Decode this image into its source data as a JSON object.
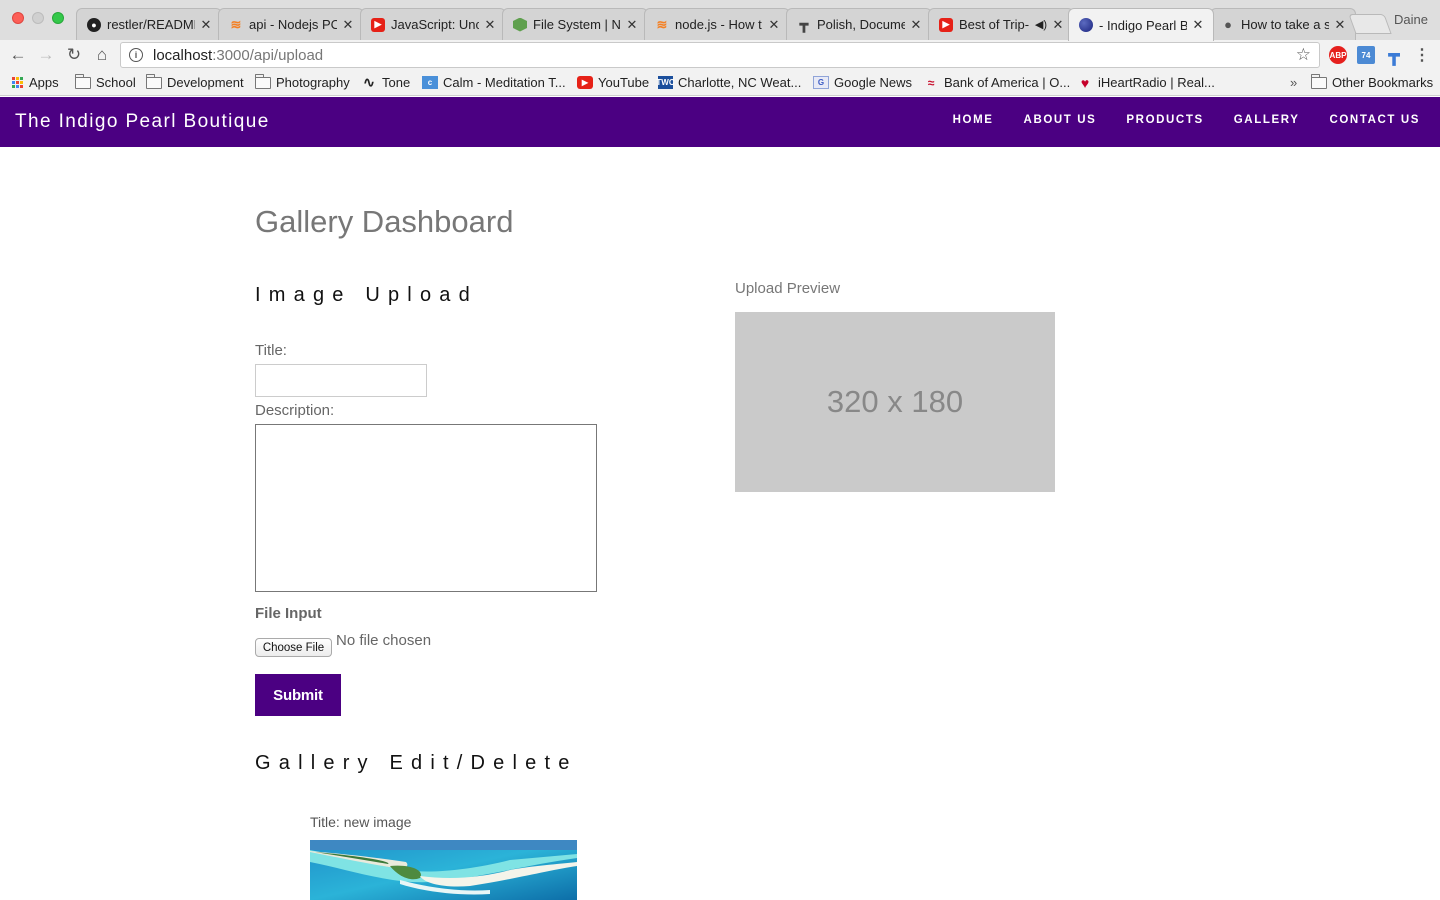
{
  "browser": {
    "tabs": [
      {
        "title": "restler/README",
        "icon": "github-icon",
        "color": "#222222",
        "active": false
      },
      {
        "title": "api - Nodejs PC",
        "icon": "stackoverflow-icon",
        "color": "#f48024",
        "active": false
      },
      {
        "title": "JavaScript: Unc",
        "icon": "youtube-icon",
        "color": "#e62117",
        "active": false
      },
      {
        "title": "File System | N",
        "icon": "nodejs-icon",
        "color": "#5fa04e",
        "active": false
      },
      {
        "title": "node.js - How t",
        "icon": "stackoverflow-icon",
        "color": "#f48024",
        "active": false
      },
      {
        "title": "Polish, Docume",
        "icon": "typewriter-icon",
        "color": "#444444",
        "active": false
      },
      {
        "title": "Best of Trip-",
        "icon": "youtube-icon",
        "color": "#e62117",
        "active": false
      },
      {
        "title": "- Indigo Pearl B",
        "icon": "globe-icon",
        "color": "#1a237e",
        "active": true
      },
      {
        "title": "How to take a s",
        "icon": "apple-icon",
        "color": "#555555",
        "active": false
      }
    ],
    "profile_name": "Daine",
    "url_host": "localhost",
    "url_path": ":3000/api/upload",
    "extensions": {
      "abp": "ABP",
      "cal": "74"
    },
    "bookmarks": [
      {
        "label": "Apps",
        "icon": "apps-grid-icon"
      },
      {
        "label": "School",
        "icon": "folder-icon"
      },
      {
        "label": "Development",
        "icon": "folder-icon"
      },
      {
        "label": "Photography",
        "icon": "folder-icon"
      },
      {
        "label": "Tone",
        "icon": "tone-wave-icon"
      },
      {
        "label": "Calm - Meditation T...",
        "icon": "calm-icon"
      },
      {
        "label": "YouTube",
        "icon": "youtube-icon"
      },
      {
        "label": "Charlotte, NC Weat...",
        "icon": "weather-channel-icon"
      },
      {
        "label": "Google News",
        "icon": "google-news-icon"
      },
      {
        "label": "Bank of America | O...",
        "icon": "bank-of-america-icon"
      },
      {
        "label": "iHeartRadio | Real...",
        "icon": "iheartradio-icon"
      }
    ],
    "bookmarks_overflow": "»",
    "other_bookmarks": "Other Bookmarks"
  },
  "site": {
    "brand": "The Indigo Pearl Boutique",
    "nav": [
      "HOME",
      "ABOUT US",
      "PRODUCTS",
      "GALLERY",
      "CONTACT US"
    ],
    "accent_color": "#4b0082"
  },
  "dashboard": {
    "page_title": "Gallery Dashboard",
    "upload": {
      "section_title": "Image Upload",
      "title_label": "Title:",
      "title_value": "",
      "description_label": "Description:",
      "description_value": "",
      "file_label": "File Input",
      "choose_file": "Choose File",
      "no_file": "No file chosen",
      "submit": "Submit"
    },
    "preview": {
      "label": "Upload Preview",
      "placeholder": "320 x 180"
    },
    "edit": {
      "section_title": "Gallery Edit/Delete",
      "items": [
        {
          "title": "Title: new image",
          "image": "tropical-island-aerial-photo"
        }
      ]
    }
  }
}
